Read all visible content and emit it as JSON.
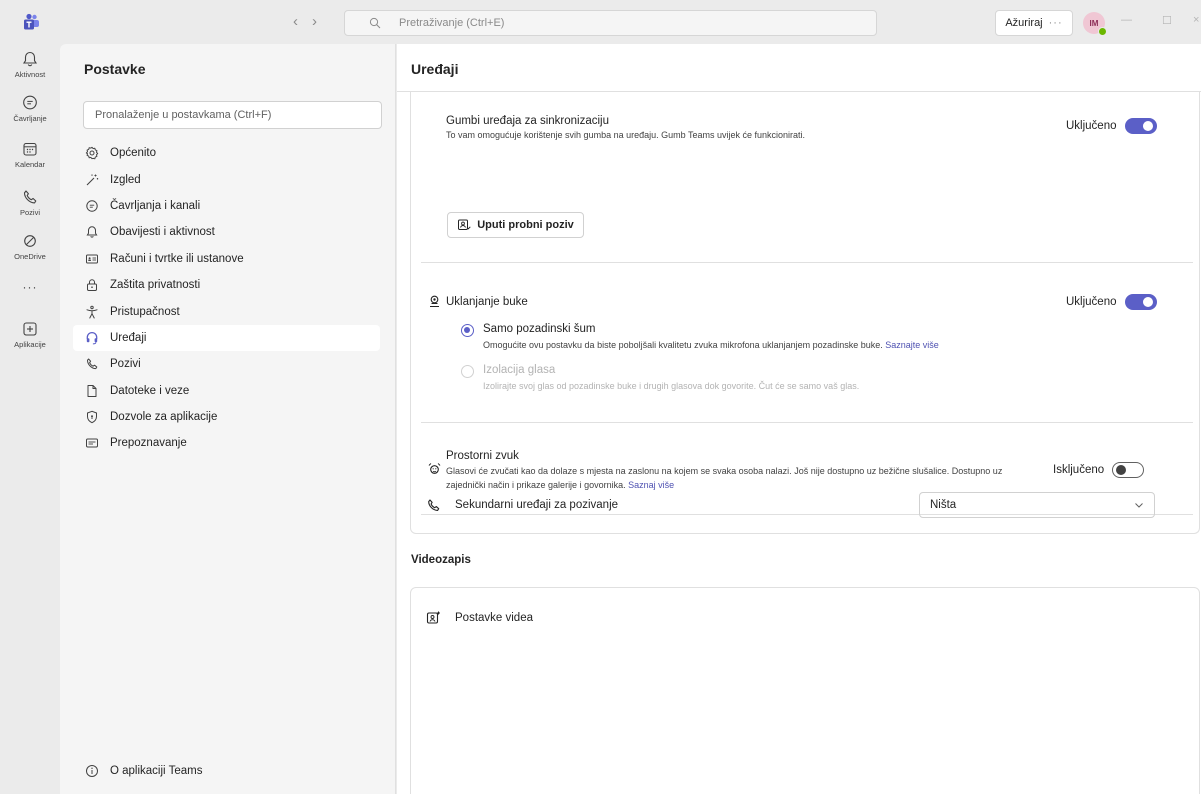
{
  "titlebar": {
    "search_placeholder": "Pretraživanje (Ctrl+E)",
    "update_label": "Ažuriraj",
    "update_more": "···",
    "avatar_initials": "IM"
  },
  "rail": {
    "items": [
      {
        "label": "Aktivnost",
        "icon": "bell-icon"
      },
      {
        "label": "Čavrljanje",
        "icon": "chat-icon"
      },
      {
        "label": "Kalendar",
        "icon": "calendar-icon"
      },
      {
        "label": "Pozivi",
        "icon": "phone-icon"
      },
      {
        "label": "OneDrive",
        "icon": "cloud-icon"
      },
      {
        "label": "···",
        "icon": "more-icon"
      },
      {
        "label": "Aplikacije",
        "icon": "add-apps-icon"
      }
    ]
  },
  "sidebar": {
    "title": "Postavke",
    "search_placeholder": "Pronalaženje u postavkama (Ctrl+F)",
    "items": [
      {
        "label": "Općenito",
        "icon": "gear-icon"
      },
      {
        "label": "Izgled",
        "icon": "wand-icon"
      },
      {
        "label": "Čavrljanja i kanali",
        "icon": "chat-icon"
      },
      {
        "label": "Obavijesti i aktivnost",
        "icon": "bell-icon"
      },
      {
        "label": "Računi i tvrtke ili ustanove",
        "icon": "id-card-icon"
      },
      {
        "label": "Zaštita privatnosti",
        "icon": "lock-icon"
      },
      {
        "label": "Pristupačnost",
        "icon": "accessibility-icon"
      },
      {
        "label": "Uređaji",
        "icon": "headset-icon",
        "active": true
      },
      {
        "label": "Pozivi",
        "icon": "phone-icon"
      },
      {
        "label": "Datoteke i veze",
        "icon": "file-icon"
      },
      {
        "label": "Dozvole za aplikacije",
        "icon": "shield-icon"
      },
      {
        "label": "Prepoznavanje",
        "icon": "caption-icon"
      }
    ],
    "about": "O aplikaciji Teams"
  },
  "main": {
    "title": "Uređaji",
    "sync_buttons": {
      "title": "Gumbi uređaja za sinkronizaciju",
      "desc": "To vam omogućuje korištenje svih gumba na uređaju. Gumb Teams uvijek će funkcionirati.",
      "state": "Uključeno",
      "test_call": "Uputi probni poziv"
    },
    "noise": {
      "title": "Uklanjanje buke",
      "state": "Uključeno",
      "opt1_label": "Samo pozadinski šum",
      "opt1_desc": "Omogućite ovu postavku da biste poboljšali kvalitetu zvuka mikrofona uklanjanjem pozadinske buke.",
      "opt1_link": "Saznajte više",
      "opt2_label": "Izolacija glasa",
      "opt2_desc": "Izolirajte svoj glas od pozadinske buke i drugih glasova dok govorite. Čut će se samo vaš glas."
    },
    "spatial": {
      "title": "Prostorni zvuk",
      "desc_line1": "Glasovi će zvučati kao da dolaze s mjesta na zaslonu na kojem se svaka osoba nalazi. Još nije dostupno uz bežične slušalice. Dostupno uz",
      "desc_line2": "zajednički način i prikaze galerije i govornika.",
      "link": "Saznaj više",
      "state": "Isključeno"
    },
    "secondary": {
      "title": "Sekundarni uređaji za pozivanje",
      "value": "Ništa"
    },
    "video_section": "Videozapis",
    "video_settings": "Postavke videa"
  },
  "colors": {
    "accent": "#5b5fc7",
    "link": "#4f52b2"
  }
}
